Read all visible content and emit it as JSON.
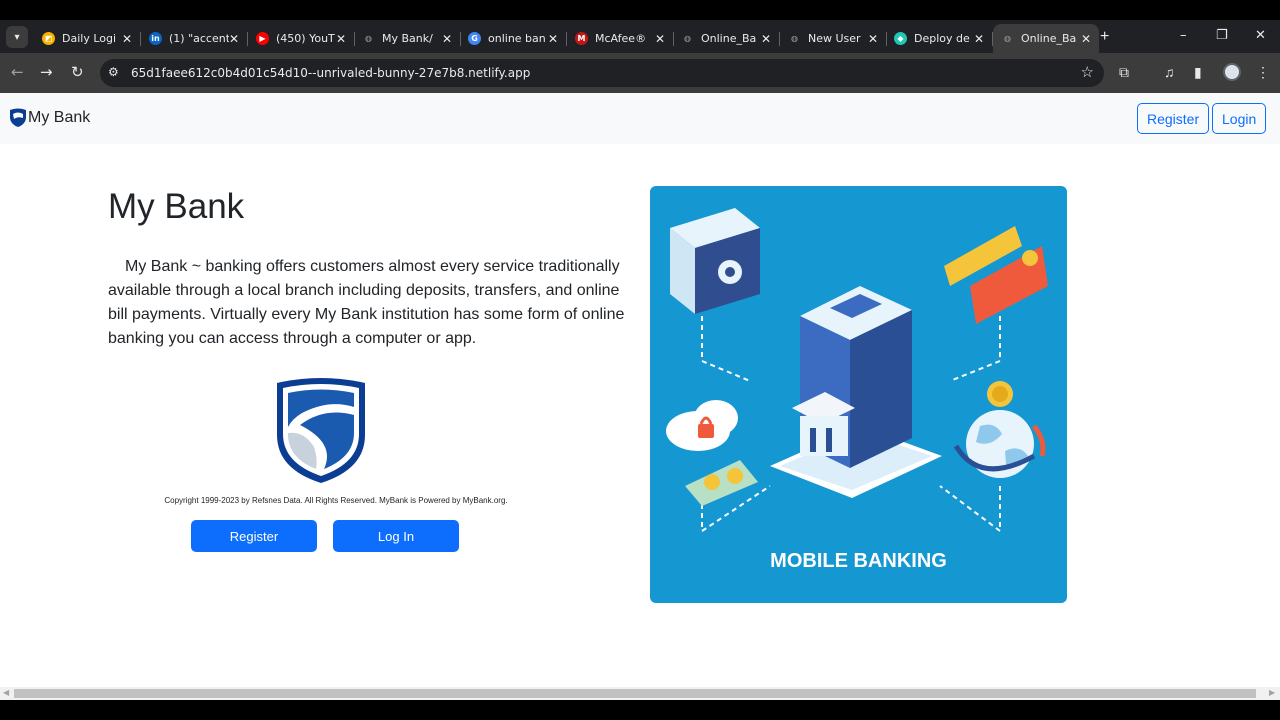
{
  "browser": {
    "tabs": [
      {
        "label": "Daily Logi",
        "favicon": "airtable-icon",
        "color": "#f5b400"
      },
      {
        "label": "(1) \"accent",
        "favicon": "linkedin-icon",
        "color": "#0a66c2"
      },
      {
        "label": "(450) YouT",
        "favicon": "youtube-icon",
        "color": "#ff0000"
      },
      {
        "label": "My Bank/",
        "favicon": "globe-icon",
        "color": "#9aa0a6"
      },
      {
        "label": "online ban",
        "favicon": "google-icon",
        "color": "#4285f4"
      },
      {
        "label": "McAfee®",
        "favicon": "mcafee-icon",
        "color": "#c01818"
      },
      {
        "label": "Online_Ba",
        "favicon": "globe-icon",
        "color": "#9aa0a6"
      },
      {
        "label": "New User",
        "favicon": "globe-icon",
        "color": "#9aa0a6"
      },
      {
        "label": "Deploy de",
        "favicon": "netlify-icon",
        "color": "#20c6b7"
      },
      {
        "label": "Online_Ba",
        "favicon": "globe-icon",
        "color": "#9aa0a6",
        "active": true
      }
    ],
    "url": "65d1faee612c0b4d01c54d10--unrivaled-bunny-27e7b8.netlify.app"
  },
  "navbar": {
    "brand": "My Bank",
    "register_label": "Register",
    "login_label": "Login"
  },
  "main": {
    "title": "My Bank",
    "description": "My Bank ~ banking offers customers almost every service traditionally available through a local branch including deposits, transfers, and online bill payments. Virtually every My Bank institution has some form of online banking you can access through a computer or app.",
    "copyright": "Copyright 1999-2023 by Refsnes Data. All Rights Reserved. MyBank is Powered by MyBank.org.",
    "register_button": "Register",
    "login_button": "Log In",
    "hero_caption": "MOBILE BANKING"
  },
  "colors": {
    "primary": "#0d6efd",
    "hero_bg": "#1597d2",
    "navbar_bg": "#f8f9fa"
  }
}
